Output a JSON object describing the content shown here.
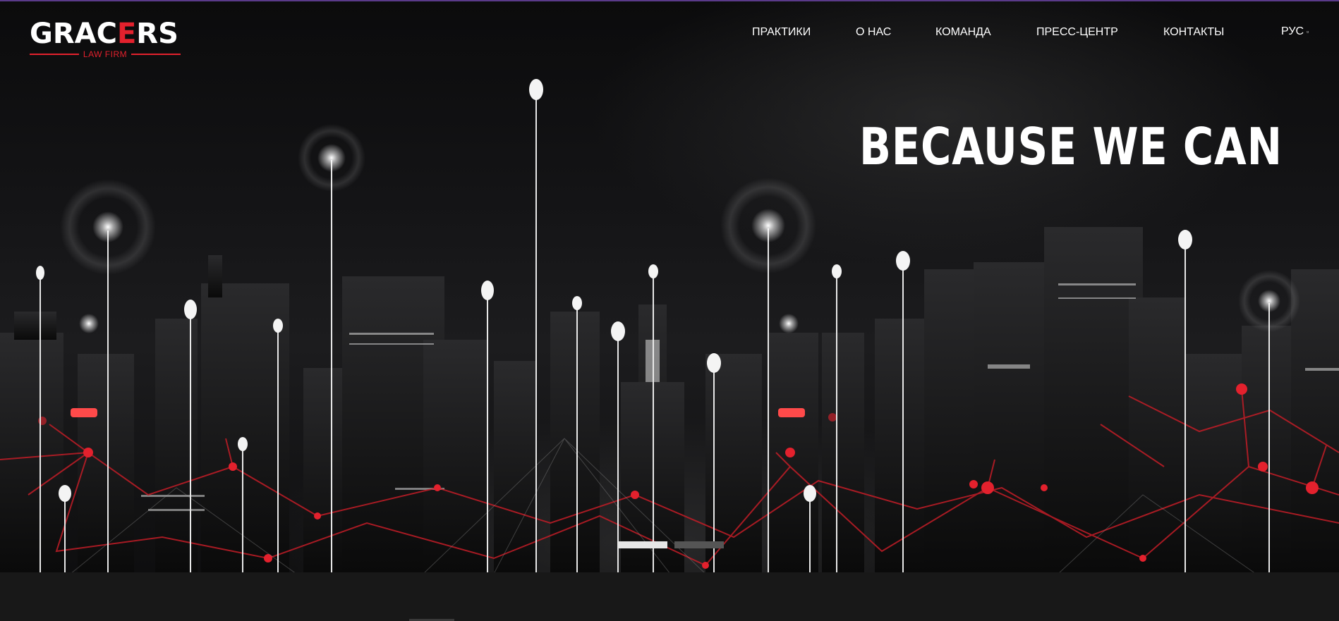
{
  "brand": {
    "name_part1": "GRAC",
    "name_accent": "E",
    "name_part2": "RS",
    "subtitle": "LAW FIRM"
  },
  "nav": {
    "items": [
      {
        "label": "ПРАКТИКИ"
      },
      {
        "label": "О НАС"
      },
      {
        "label": "КОМАНДА"
      },
      {
        "label": "ПРЕСС-ЦЕНТР"
      },
      {
        "label": "КОНТАКТЫ"
      }
    ],
    "language": "РУС",
    "language_icon": "chevron-down-icon"
  },
  "hero": {
    "headline": "BECAUSE WE CAN",
    "background": "night-city-skyline-with-light-poles-and-red-network"
  },
  "slider": {
    "slides_count": 2,
    "active_index": 0
  },
  "colors": {
    "accent": "#e3212d",
    "background": "#181818",
    "text": "#ffffff"
  }
}
